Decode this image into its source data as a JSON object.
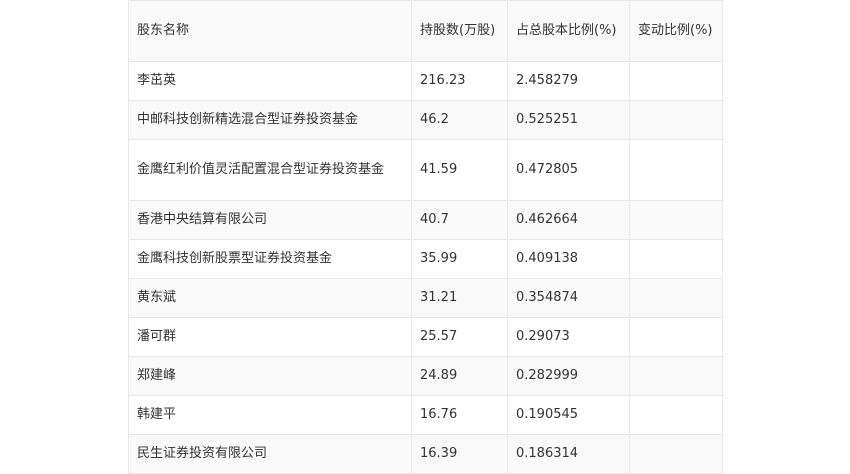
{
  "table": {
    "headers": [
      "股东名称",
      "持股数(万股)",
      "占总股本比例(%)",
      "变动比例(%)"
    ],
    "rows": [
      [
        "李茁英",
        "216.23",
        "2.458279",
        ""
      ],
      [
        "中邮科技创新精选混合型证券投资基金",
        "46.2",
        "0.525251",
        ""
      ],
      [
        "金鹰红利价值灵活配置混合型证券投资基金",
        "41.59",
        "0.472805",
        ""
      ],
      [
        "香港中央结算有限公司",
        "40.7",
        "0.462664",
        ""
      ],
      [
        "金鹰科技创新股票型证券投资基金",
        "35.99",
        "0.409138",
        ""
      ],
      [
        "黄东斌",
        "31.21",
        "0.354874",
        ""
      ],
      [
        "潘可群",
        "25.57",
        "0.29073",
        ""
      ],
      [
        "郑建峰",
        "24.89",
        "0.282999",
        ""
      ],
      [
        "韩建平",
        "16.76",
        "0.190545",
        ""
      ],
      [
        "民生证券投资有限公司",
        "16.39",
        "0.186314",
        ""
      ]
    ]
  },
  "colors": {
    "border": "#e8e8e8",
    "stripe": "#f9f9f9",
    "text": "#333333"
  }
}
